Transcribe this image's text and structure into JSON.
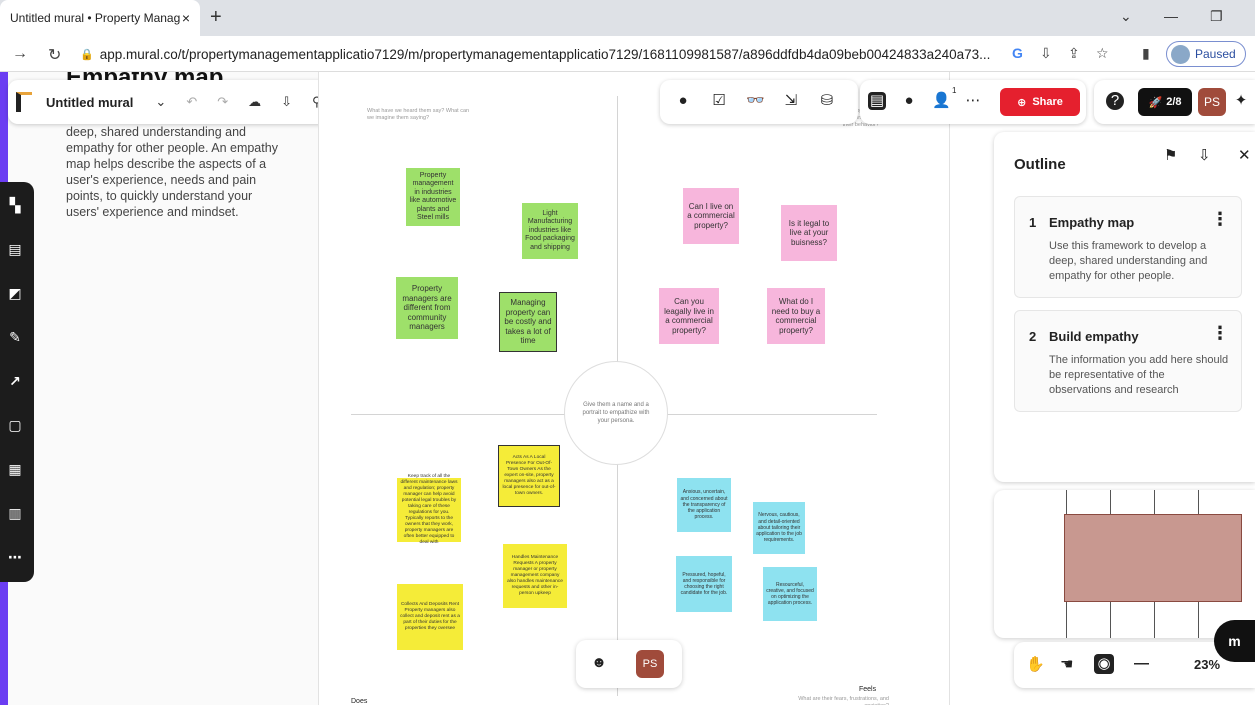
{
  "browser": {
    "tab_title": "Untitled mural • Property Manag",
    "tab_close": "×",
    "new_tab": "+",
    "url": "app.mural.co/t/propertymanagementapplicatio7129/m/propertymanagementapplicatio7129/1681109981587/a896ddfdb4da09beb00424833a240a73...",
    "profile_status": "Paused"
  },
  "left_panel": {
    "title": "Empathy map",
    "description": "deep, shared understanding and empathy for other people. An empathy map helps describe the aspects of a user's experience, needs and pain points, to quickly understand your users' experience and mindset."
  },
  "mural_toolbar": {
    "title": "Untitled mural"
  },
  "canvas": {
    "persona_text": "Give them a name and a portrait to empathize with your persona.",
    "q_says_hint": "What have we heard them say? What can we imagine them saying?",
    "q_thinks_hint": "What are their wants, needs, hopes and dreams? What other thoughts might influence their behavior?",
    "q_does_label": "Does",
    "q_feels_label": "Feels",
    "q_feels_hint": "What are their fears, frustrations, and anxieties?",
    "stickies": {
      "g1": "Property management in industries like automotive plants and Steel mills",
      "g2": "Light Manufacturing industries like Food packaging and shipping",
      "g3": "Property managers are different from community managers",
      "g4": "Managing property can be costly and takes a lot of time",
      "p1": "Can I live on a commercial property?",
      "p2": "Is it legal to live at your buisness?",
      "p3": "Can you leagally live in a commercial property?",
      "p4": "What do I need to buy a commercial property?",
      "y1": "Acts As A Local Presence For Out-Of-Town Owners As the expert on-site, property managers also act as a local presence for out-of-town owners.",
      "y2": "Keep track of all the different maintenance laws and regulation; property manager can help avoid potential legal troubles by taking care of these regulations for you. Typically reports to the owners that they work, property managers are often better equipped to deal with",
      "y3": "Handles Maintenance Requests A property manager or property management company also handles maintenance requests and other in-person upkeep",
      "y4": "Collects And Deposits Rent Property managers also collect and deposit rent as a part of their duties for the properties they oversee",
      "b1": "Anxious, uncertain, and concerned about the transparency of the application process.",
      "b2": "Nervous, cautious, and detail-oriented about tailoring their application to the job requirements.",
      "b3": "Pressured, hopeful, and responsible for choosing the right candidate for the job.",
      "b4": "Resourceful, creative, and focused on optimizing the application process."
    }
  },
  "right_toolbar": {
    "share_label": "Share",
    "notif_count": "1"
  },
  "far_right_toolbar": {
    "timer_label": "2/8",
    "user_initials": "PS"
  },
  "outline": {
    "title": "Outline",
    "items": [
      {
        "num": "1",
        "name": "Empathy map",
        "desc": "Use this framework to develop a deep, shared understanding and empathy for other people."
      },
      {
        "num": "2",
        "name": "Build empathy",
        "desc": "The information you add here should be representative of the observations and research"
      }
    ]
  },
  "zoom": {
    "value": "23%"
  },
  "bottom_toolbar": {
    "user_initials": "PS"
  },
  "colors": {
    "accent_purple": "#6b3df2",
    "share_red": "#e5202e",
    "user_brown": "#a04b3b"
  }
}
